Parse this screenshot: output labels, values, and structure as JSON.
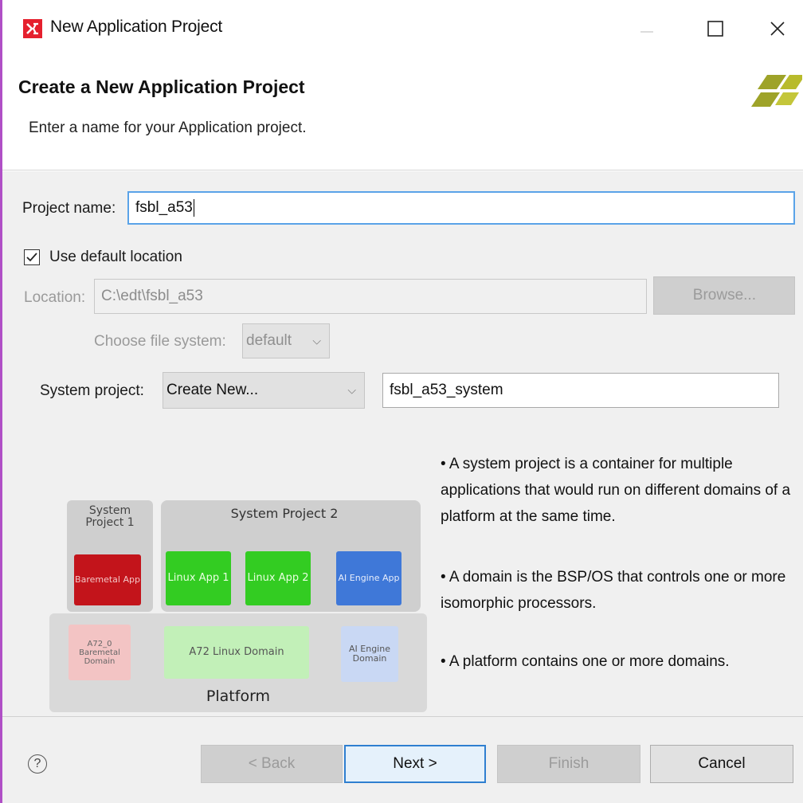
{
  "window": {
    "title": "New Application Project",
    "controls": {
      "minimize": "—",
      "maximize": "☐",
      "close": "✕"
    }
  },
  "header": {
    "title": "Create a New Application Project",
    "description": "Enter a name for your Application project."
  },
  "form": {
    "project_name_label": "Project name:",
    "project_name_value": "fsbl_a53",
    "use_default_location_label": "Use default location",
    "use_default_location_checked": true,
    "location_label": "Location:",
    "location_value": "C:\\edt\\fsbl_a53",
    "browse_label": "Browse...",
    "file_system_label": "Choose file system:",
    "file_system_value": "default",
    "system_project_label": "System project:",
    "system_project_value": "Create New...",
    "system_project_name": "fsbl_a53_system"
  },
  "diagram": {
    "system_project_1": "System Project 1",
    "system_project_2": "System Project 2",
    "baremetal_app": "Baremetal App",
    "linux_app_1": "Linux App 1",
    "linux_app_2": "Linux App 2",
    "ai_engine_app": "AI Engine App",
    "a72_baremetal_domain": "A72_0 Baremetal Domain",
    "a72_linux_domain": "A72 Linux Domain",
    "ai_engine_domain": "AI Engine Domain",
    "platform": "Platform"
  },
  "info": {
    "bullet_1": "• A system project is a container for multiple applications that would run on different domains of a platform at the same time.",
    "bullet_2": "• A domain is the BSP/OS that controls one or more isomorphic processors.",
    "bullet_3": "• A platform contains one or more domains."
  },
  "footer": {
    "help": "?",
    "back": "< Back",
    "next": "Next >",
    "finish": "Finish",
    "cancel": "Cancel"
  },
  "colors": {
    "accent": "#2f7fd0",
    "focus": "#5aa3e8",
    "brand_red": "#e5202e",
    "baremetal_app": "#c3141b",
    "linux_app": "#33cc22",
    "ai_engine_app": "#3f78d8"
  }
}
